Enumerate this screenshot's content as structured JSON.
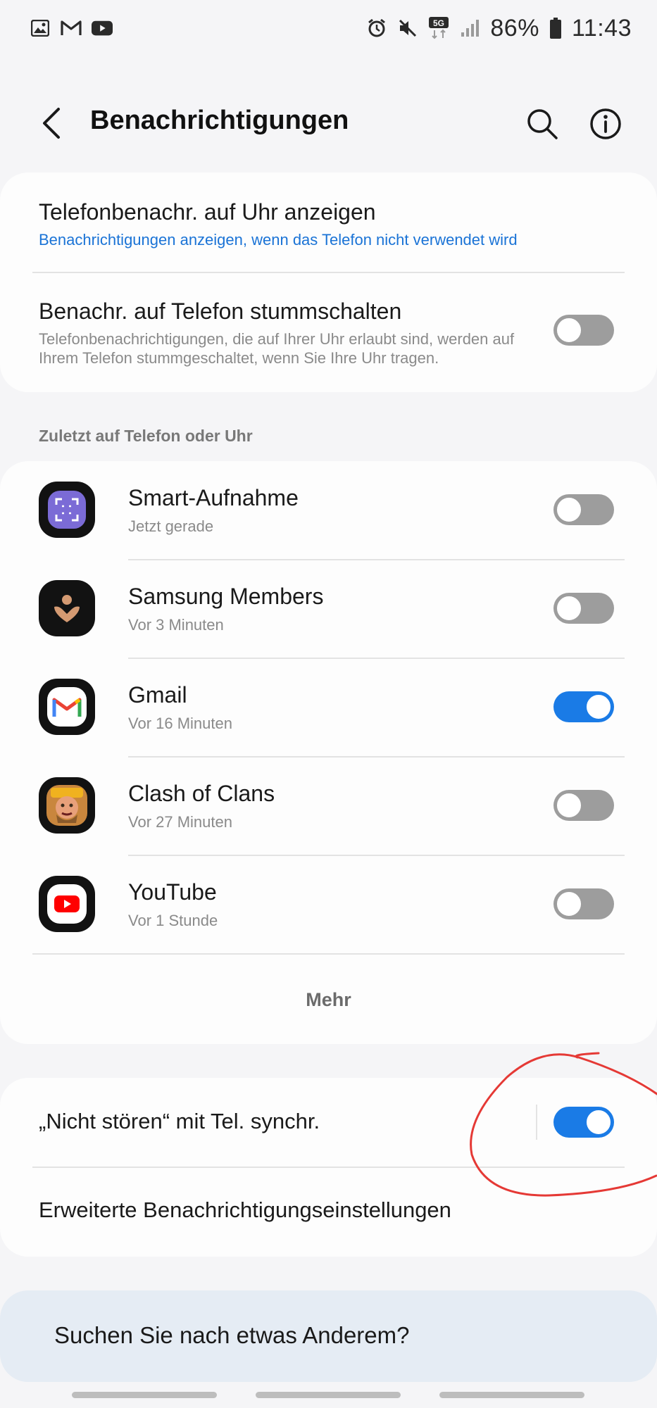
{
  "status_bar": {
    "battery": "86%",
    "time": "11:43",
    "network": "5G",
    "left_icons": [
      "gallery-icon",
      "gmail-icon",
      "youtube-icon"
    ],
    "right_icons": [
      "alarm-icon",
      "mute-icon",
      "network-5g-icon",
      "signal-icon",
      "battery-icon"
    ]
  },
  "header": {
    "title": "Benachrichtigungen"
  },
  "watch_settings": {
    "show_on_watch": {
      "title": "Telefonbenachr. auf Uhr anzeigen",
      "subtitle": "Benachrichtigungen anzeigen, wenn das Telefon nicht verwendet wird"
    },
    "mute_on_phone": {
      "title": "Benachr. auf Telefon stummschalten",
      "subtitle": "Telefonbenachrichtigungen, die auf Ihrer Uhr erlaubt sind, werden auf Ihrem Telefon stummgeschaltet, wenn Sie Ihre Uhr tragen.",
      "enabled": false
    }
  },
  "recent": {
    "section_label": "Zuletzt auf Telefon oder Uhr",
    "apps": [
      {
        "name": "Smart-Aufnahme",
        "time": "Jetzt gerade",
        "enabled": false,
        "icon": "smart-capture-icon"
      },
      {
        "name": "Samsung Members",
        "time": "Vor 3 Minuten",
        "enabled": false,
        "icon": "samsung-members-icon"
      },
      {
        "name": "Gmail",
        "time": "Vor 16 Minuten",
        "enabled": true,
        "icon": "gmail-icon"
      },
      {
        "name": "Clash of Clans",
        "time": "Vor 27 Minuten",
        "enabled": false,
        "icon": "clash-of-clans-icon"
      },
      {
        "name": "YouTube",
        "time": "Vor 1 Stunde",
        "enabled": false,
        "icon": "youtube-icon"
      }
    ],
    "more_label": "Mehr"
  },
  "sync": {
    "dnd_label": "„Nicht stören“ mit Tel. synchr.",
    "dnd_enabled": true,
    "advanced_label": "Erweiterte Benachrichtigungseinstellungen"
  },
  "search_card": {
    "text": "Suchen Sie nach etwas Anderem?"
  },
  "colors": {
    "accent": "#1a7be6",
    "link": "#1a73d6",
    "annotation": "#e53935"
  }
}
